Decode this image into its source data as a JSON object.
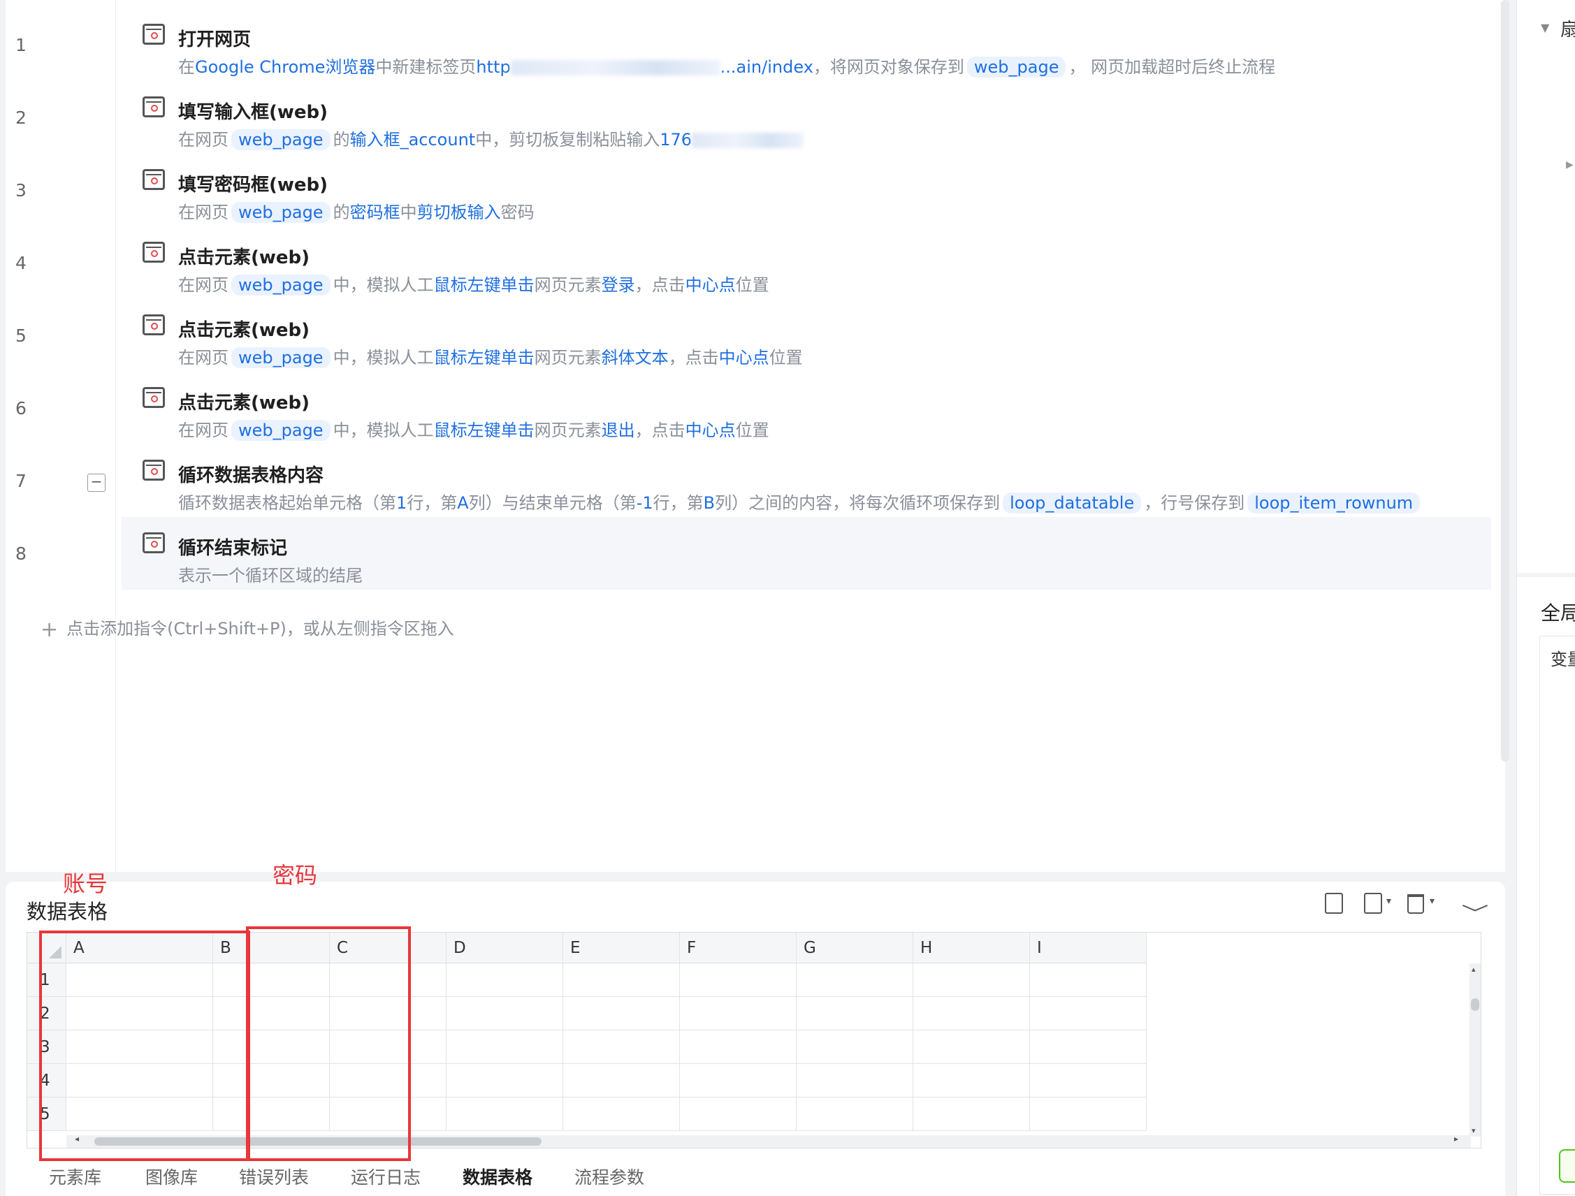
{
  "line_numbers": [
    "1",
    "2",
    "3",
    "4",
    "5",
    "6",
    "7",
    "8"
  ],
  "steps": [
    {
      "title": "打开网页",
      "desc": [
        {
          "t": "在"
        },
        {
          "t": "Google Chrome浏览器",
          "k": 1
        },
        {
          "t": "中新建标签页"
        },
        {
          "t": "http",
          "k": 1
        },
        {
          "b": 1
        },
        {
          "t": "...ain/index",
          "k": 1
        },
        {
          "t": "，将网页对象保存到"
        },
        {
          "t": "web_page",
          "v": 1
        },
        {
          "t": "， 网页加载超时后终止流程"
        }
      ]
    },
    {
      "title": "填写输入框(web)",
      "desc": [
        {
          "t": "在网页"
        },
        {
          "t": "web_page",
          "v": 1
        },
        {
          "t": "的"
        },
        {
          "t": "输入框_account",
          "k": 1
        },
        {
          "t": "中，剪切板复制粘贴输入"
        },
        {
          "t": "176",
          "k": 1
        },
        {
          "bs": 1
        }
      ]
    },
    {
      "title": "填写密码框(web)",
      "desc": [
        {
          "t": "在网页"
        },
        {
          "t": "web_page",
          "v": 1
        },
        {
          "t": "的"
        },
        {
          "t": "密码框",
          "k": 1
        },
        {
          "t": "中"
        },
        {
          "t": "剪切板输入",
          "k": 1
        },
        {
          "t": "密码"
        }
      ]
    },
    {
      "title": "点击元素(web)",
      "desc": [
        {
          "t": "在网页"
        },
        {
          "t": "web_page",
          "v": 1
        },
        {
          "t": "中，模拟人工"
        },
        {
          "t": "鼠标左键单击",
          "k": 1
        },
        {
          "t": "网页元素"
        },
        {
          "t": "登录",
          "k": 1
        },
        {
          "t": "，点击"
        },
        {
          "t": "中心点",
          "k": 1
        },
        {
          "t": "位置"
        }
      ]
    },
    {
      "title": "点击元素(web)",
      "desc": [
        {
          "t": "在网页"
        },
        {
          "t": "web_page",
          "v": 1
        },
        {
          "t": "中，模拟人工"
        },
        {
          "t": "鼠标左键单击",
          "k": 1
        },
        {
          "t": "网页元素"
        },
        {
          "t": "斜体文本",
          "k": 1
        },
        {
          "t": "，点击"
        },
        {
          "t": "中心点",
          "k": 1
        },
        {
          "t": "位置"
        }
      ]
    },
    {
      "title": "点击元素(web)",
      "desc": [
        {
          "t": "在网页"
        },
        {
          "t": "web_page",
          "v": 1
        },
        {
          "t": "中，模拟人工"
        },
        {
          "t": "鼠标左键单击",
          "k": 1
        },
        {
          "t": "网页元素"
        },
        {
          "t": "退出",
          "k": 1
        },
        {
          "t": "，点击"
        },
        {
          "t": "中心点",
          "k": 1
        },
        {
          "t": "位置"
        }
      ]
    },
    {
      "title": "循环数据表格内容",
      "desc": [
        {
          "t": "循环数据表格起始单元格（第"
        },
        {
          "t": "1",
          "k": 1
        },
        {
          "t": "行，第"
        },
        {
          "t": "A",
          "k": 1
        },
        {
          "t": "列）与结束单元格（第"
        },
        {
          "t": "-1",
          "k": 1
        },
        {
          "t": "行，第"
        },
        {
          "t": "B",
          "k": 1
        },
        {
          "t": "列）之间的内容，将每次循环项保存到"
        },
        {
          "t": "loop_datatable",
          "v": 1
        },
        {
          "t": "，行号保存到"
        },
        {
          "t": "loop_item_rownum",
          "v": 1
        }
      ]
    },
    {
      "title": "循环结束标记",
      "desc": [
        {
          "t": "表示一个循环区域的结尾"
        }
      ]
    }
  ],
  "collapse_symbol": "−",
  "add_command": {
    "icon": "+",
    "label": "点击添加指令(Ctrl+Shift+P)，或从左侧指令区拖入"
  },
  "right_panel": {
    "tri": "▼",
    "tri2": "▶",
    "head": "扇",
    "global": "全局",
    "var_head": "变量"
  },
  "data_table": {
    "title": "数据表格",
    "collapse_symbol": "﹀",
    "caret": "▾",
    "columns": [
      "A",
      "B",
      "C",
      "D",
      "E",
      "F",
      "G",
      "H",
      "I"
    ],
    "rows": [
      "1",
      "2",
      "3",
      "4",
      "5"
    ],
    "scroll": {
      "left": "◂",
      "right": "▸",
      "up": "▴",
      "down": "▾"
    }
  },
  "annotations": {
    "account": "账号",
    "password": "密码"
  },
  "bottom_tabs": [
    {
      "label": "元素库"
    },
    {
      "label": "图像库"
    },
    {
      "label": "错误列表"
    },
    {
      "label": "运行日志"
    },
    {
      "label": "数据表格",
      "active": true
    },
    {
      "label": "流程参数"
    }
  ],
  "colors": {
    "accent": "#1f6fe0",
    "annotation": "#e8373a",
    "muted": "#8a8f99"
  }
}
